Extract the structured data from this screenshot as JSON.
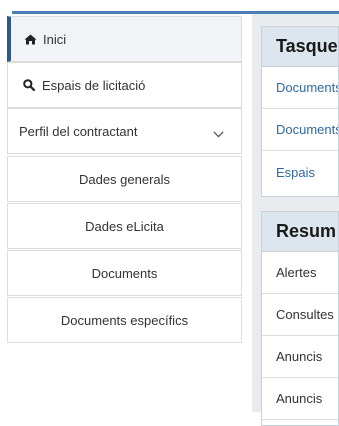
{
  "sidebar": {
    "items": [
      {
        "label": "Inici",
        "icon": "home-icon"
      },
      {
        "label": "Espais de licitació",
        "icon": "search-icon"
      },
      {
        "label": "Perfil del contractant",
        "icon": "chevron-down-icon"
      },
      {
        "label": "Dades generals"
      },
      {
        "label": "Dades eLicita"
      },
      {
        "label": "Documents"
      },
      {
        "label": "Documents específics"
      }
    ]
  },
  "tasques": {
    "title": "Tasques",
    "rows": [
      "Documents",
      "Documents",
      "Espais"
    ]
  },
  "resum": {
    "title": "Resum",
    "rows": [
      "Alertes",
      "Consultes",
      "Anuncis",
      "Anuncis"
    ]
  },
  "colors": {
    "accent": "#2c5a8a",
    "link": "#2c6aa0",
    "card_header": "#dde6ef",
    "panel_background": "#e9ecef"
  }
}
